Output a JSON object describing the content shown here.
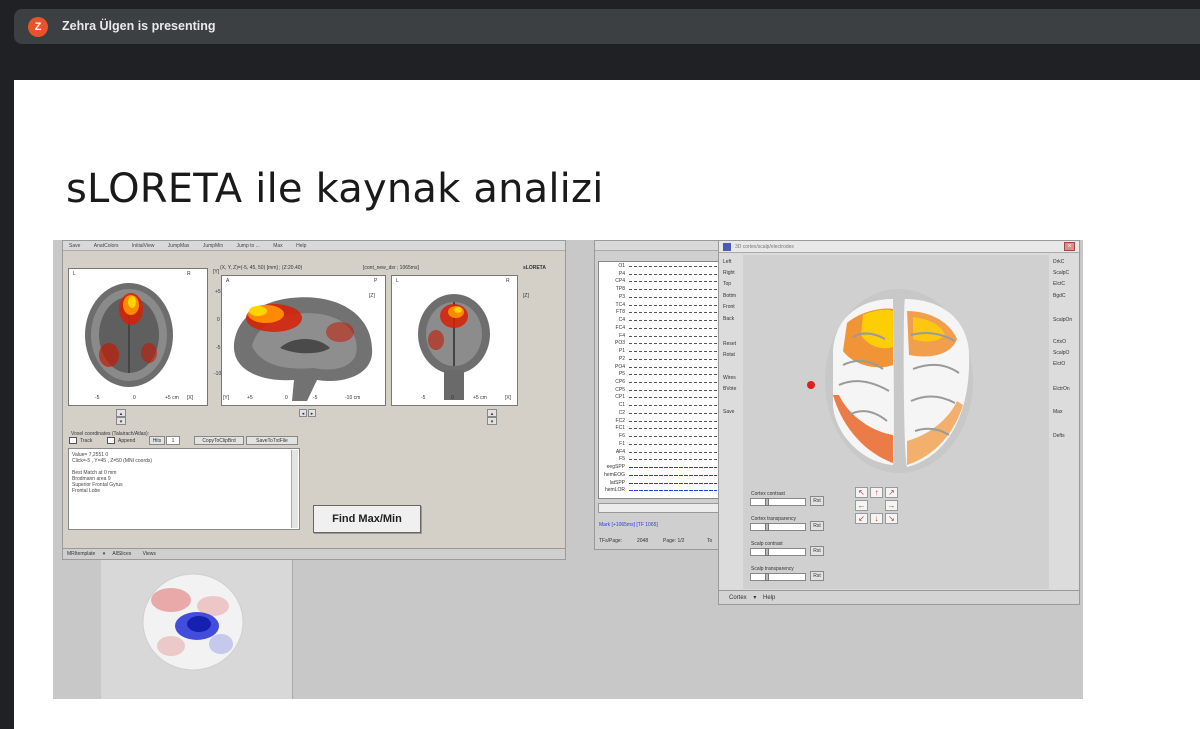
{
  "meeting": {
    "avatar_letter": "Z",
    "presenting_text": "Zehra Ülgen is presenting"
  },
  "slide": {
    "title": "sLORETA ile kaynak analizi"
  },
  "viewer": {
    "menu": [
      "Save",
      "AnatColors",
      "InitialView",
      "JumpMax",
      "JumpMin",
      "Jump to ...",
      "Max",
      "Help"
    ],
    "coords_text": "(X, Y, Z)=(-5, 45, 50) [mm] ; (Z:20.40)",
    "file_text": "[cont_new_dsr ; 1065ms]",
    "brand": "sLORETA",
    "axial_labels": {
      "top_left": "L",
      "top_right": "R",
      "y": "[Y]",
      "ticks": [
        "+5",
        "0",
        "-5",
        "-10"
      ],
      "xticks": [
        "-5",
        "0",
        "+5 cm",
        "[X]"
      ]
    },
    "sagittal_labels": {
      "a": "A",
      "p": "P",
      "z": "[Z]",
      "xticks": [
        "[Y]",
        "+5",
        "0",
        "-5",
        "-10 cm"
      ]
    },
    "coronal_labels": {
      "l": "L",
      "r": "R",
      "z": "[Z]",
      "xticks": [
        "-5",
        "0",
        "+5 cm",
        "[X]"
      ]
    },
    "voxel_box": {
      "label": "Voxel coordinates (Talairach/Atlas):",
      "check_track": "Track",
      "check_append": "Append",
      "hits_label": "Hits",
      "hits_value": "1",
      "copy_button": "CopyToClipBrd",
      "save_button": "SaveToTxtFile"
    },
    "info_lines": [
      "Value= 7,2551 0",
      "Click=-5 , Y=45 , Z=50 (MNI coords)",
      "",
      "Best Match at 0 mm",
      "Brodmann area 9",
      "Superior Frontal Gyrus",
      "Frontal Lobe"
    ],
    "find_button": "Find Max/Min",
    "status": [
      "MRItemplate",
      "AllSlices",
      "Views"
    ]
  },
  "eeg": {
    "channels": [
      "O1",
      "P4",
      "CP4",
      "TP8",
      "P3",
      "TC4",
      "FT8",
      "C4",
      "FC4",
      "F4",
      "PO3",
      "P1",
      "P2",
      "PO4",
      "P5",
      "CP6",
      "CP5",
      "CP1",
      "C1",
      "C2",
      "FC2",
      "FC1",
      "F6",
      "F1",
      "AF4",
      "F5",
      "eegSPP",
      "hemEOG",
      "latSPP",
      "hemLOR"
    ],
    "cursor_text": "Mark [+1065ms] [TF 1065]",
    "tf_label": "TFs/Page:",
    "tf_value": "2048",
    "page_label": "Page: 1/2",
    "extra": "To"
  },
  "cortex3d": {
    "title": "3D cortex/scalp/electrodes",
    "left_buttons": [
      "Left",
      "Right",
      "Top",
      "Bottm",
      "Front",
      "Back",
      "Reset",
      "Rotat",
      "Wires",
      "BVote",
      "Save"
    ],
    "right_buttons": [
      "DrkC",
      "ScalpC",
      "ElctC",
      "BgdC",
      "ScalpOn",
      "CrtxO",
      "ScalpO",
      "ElctO",
      "ElctrOn",
      "Max",
      "Defts"
    ],
    "sliders": [
      {
        "label": "Cortex contrast",
        "btn": "Rst"
      },
      {
        "label": "Cortex transparency",
        "btn": "Rst"
      },
      {
        "label": "Scalp contrast",
        "btn": "Rst"
      },
      {
        "label": "Scalp transparency",
        "btn": "Rst"
      }
    ],
    "status": [
      "Cortex",
      "Help"
    ]
  },
  "colors": {
    "topbar": "#202124",
    "presenting_bar": "#3c4043",
    "avatar": "#e8542a",
    "activation_hot": "#ffd400",
    "activation_red": "#d81e05",
    "eeg_blue": "#2b3fd8"
  }
}
